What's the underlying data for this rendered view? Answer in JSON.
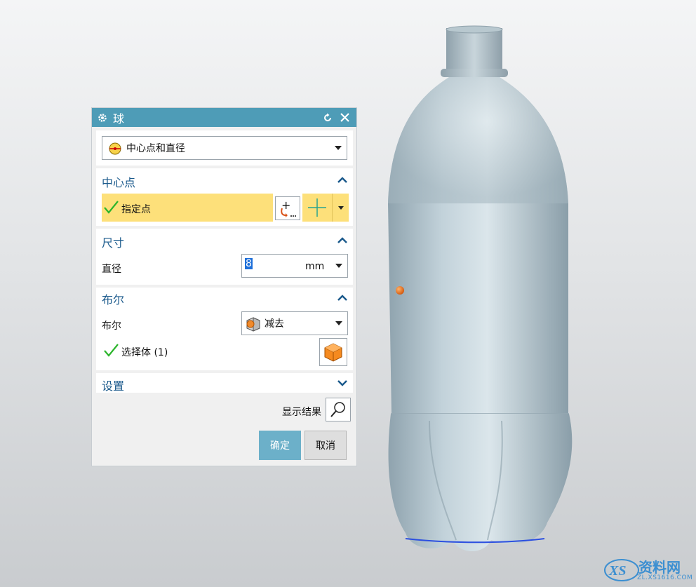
{
  "dialog": {
    "title": "球",
    "type_selector": {
      "value": "中心点和直径"
    },
    "center_section": {
      "title": "中心点",
      "point_label": "指定点",
      "point_btn_label": "+"
    },
    "dimension_section": {
      "title": "尺寸",
      "diameter_label": "直径",
      "diameter_value": "8",
      "unit": "mm"
    },
    "boolean_section": {
      "title": "布尔",
      "boolean_label": "布尔",
      "boolean_value": "减去",
      "select_body_label": "选择体 (1)"
    },
    "settings_section": {
      "title": "设置"
    },
    "show_result_label": "显示结果",
    "ok_label": "确定",
    "cancel_label": "取消"
  },
  "watermark": {
    "main": "资料网",
    "sub": "ZL.XS1616.COM"
  },
  "colors": {
    "title_bar": "#4e9cb7",
    "section_title": "#1b5a8c",
    "highlight": "#fde07a",
    "ok_button": "#6cb0c9",
    "bottle": "#aebfc8",
    "center_point": "#e56a12"
  }
}
